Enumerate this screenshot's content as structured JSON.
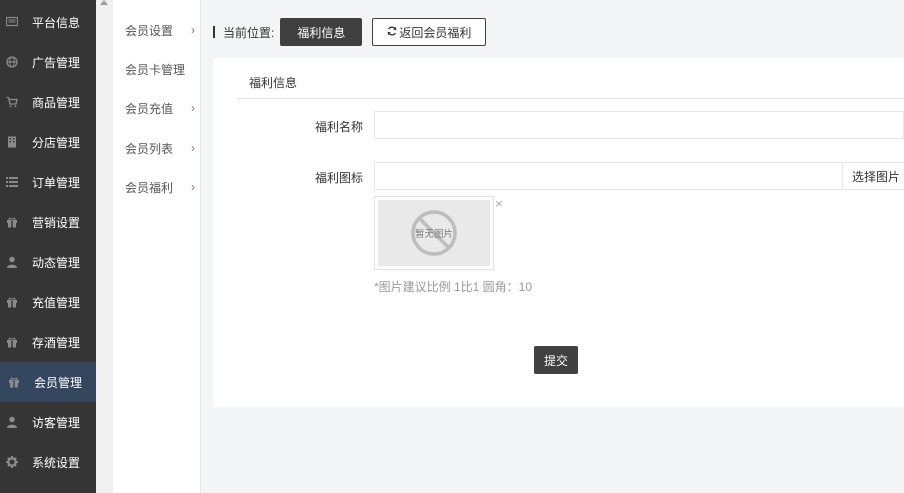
{
  "sidebar": {
    "items": [
      {
        "label": "平台信息",
        "icon": "monitor-icon"
      },
      {
        "label": "广告管理",
        "icon": "globe-icon"
      },
      {
        "label": "商品管理",
        "icon": "cart-icon"
      },
      {
        "label": "分店管理",
        "icon": "building-icon"
      },
      {
        "label": "订单管理",
        "icon": "list-icon"
      },
      {
        "label": "营销设置",
        "icon": "gift-icon"
      },
      {
        "label": "动态管理",
        "icon": "user-icon"
      },
      {
        "label": "充值管理",
        "icon": "gift-icon"
      },
      {
        "label": "存酒管理",
        "icon": "gift-icon"
      },
      {
        "label": "会员管理",
        "icon": "gift-icon"
      },
      {
        "label": "访客管理",
        "icon": "user-icon"
      },
      {
        "label": "系统设置",
        "icon": "gear-icon"
      }
    ],
    "active_index": 9
  },
  "submenu": {
    "items": [
      {
        "label": "会员设置",
        "has_children": true
      },
      {
        "label": "会员卡管理",
        "has_children": false
      },
      {
        "label": "会员充值",
        "has_children": true
      },
      {
        "label": "会员列表",
        "has_children": true
      },
      {
        "label": "会员福利",
        "has_children": true
      }
    ]
  },
  "breadcrumb": {
    "prefix": "当前位置:",
    "current": "福利信息",
    "back_label": "返回会员福利"
  },
  "form": {
    "section_title": "福利信息",
    "name_label": "福利名称",
    "name_value": "",
    "icon_label": "福利图标",
    "icon_value": "",
    "choose_label": "选择图片",
    "no_image_text": "暂无图片",
    "hint": "*图片建议比例 1比1 圆角：10",
    "submit_label": "提交"
  },
  "colors": {
    "sidebar_bg": "#353535",
    "sidebar_active": "#35475e",
    "button_dark": "#404040"
  }
}
